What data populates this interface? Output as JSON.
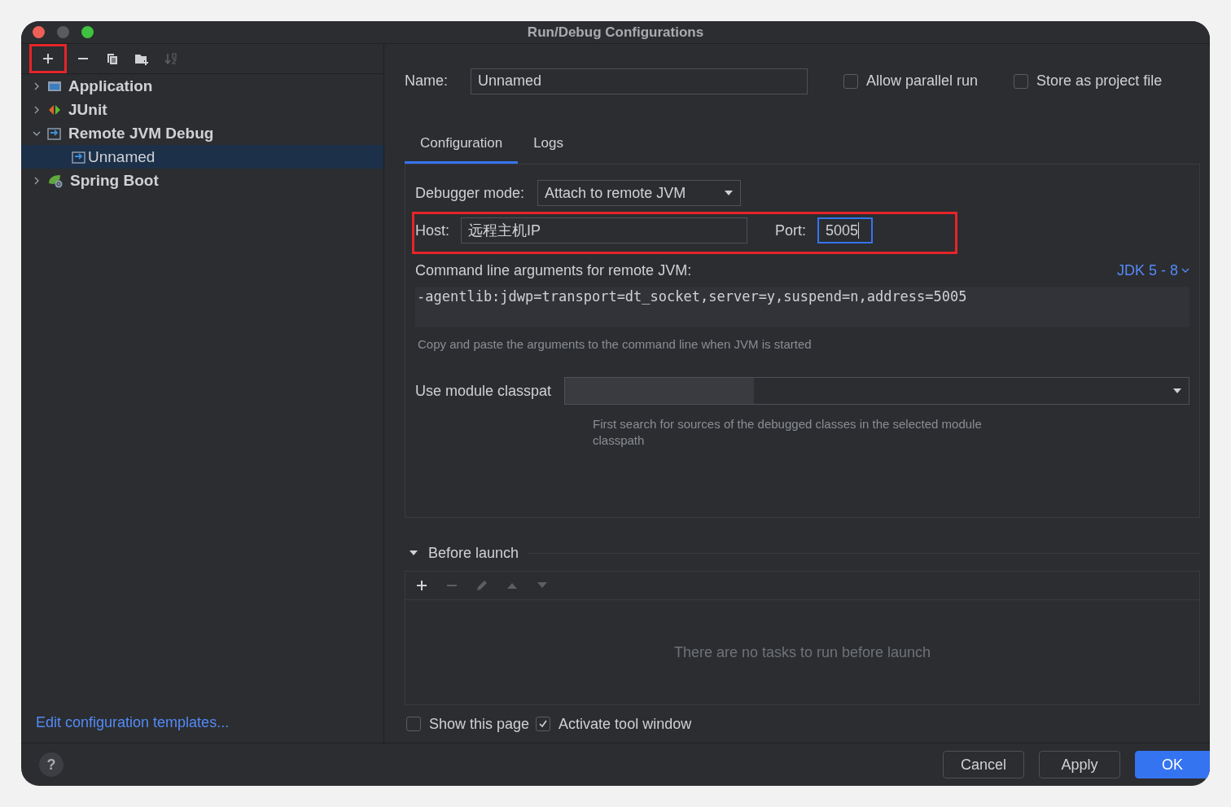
{
  "window": {
    "title": "Run/Debug Configurations"
  },
  "toolbar": [
    {
      "kind": "add",
      "disabled": false,
      "highlighted": true
    },
    {
      "kind": "remove",
      "disabled": false,
      "highlighted": false
    },
    {
      "kind": "copy",
      "disabled": false,
      "highlighted": false
    },
    {
      "kind": "folder",
      "disabled": false,
      "highlighted": false
    },
    {
      "kind": "sort",
      "disabled": true,
      "highlighted": false
    }
  ],
  "tree": [
    {
      "label": "Application",
      "kind": "application",
      "expanded": false,
      "selected": false
    },
    {
      "label": "JUnit",
      "kind": "junit",
      "expanded": false,
      "selected": false
    },
    {
      "label": "Remote JVM Debug",
      "kind": "remote",
      "expanded": true,
      "selected": false,
      "children": [
        {
          "label": "Unnamed",
          "kind": "remote",
          "selected": true
        }
      ]
    },
    {
      "label": "Spring Boot",
      "kind": "spring",
      "expanded": false,
      "selected": false
    }
  ],
  "help_button": "?",
  "edit_templates_link": "Edit configuration templates...",
  "name": {
    "label": "Name:",
    "value": "Unnamed"
  },
  "options": [
    {
      "label": "Allow parallel run",
      "checked": false
    },
    {
      "label": "Store as project file",
      "checked": false
    }
  ],
  "tabs": [
    {
      "label": "Configuration",
      "selected": true
    },
    {
      "label": "Logs",
      "selected": false
    }
  ],
  "debugger_mode": {
    "label": "Debugger mode:",
    "value": "Attach to remote JVM"
  },
  "host": {
    "label": "Host:",
    "value": "远程主机IP",
    "highlighted": true
  },
  "port": {
    "label": "Port:",
    "value": "5005",
    "focused": true
  },
  "command_line": {
    "label": "Command line arguments for remote JVM:",
    "jdk": "JDK 5 - 8",
    "value": "-agentlib:jdwp=transport=dt_socket,server=y,suspend=n,address=5005",
    "hint": "Copy and paste the arguments to the command line when JVM is started"
  },
  "module_classpath": {
    "label": "Use module classpat",
    "hint": "First search for sources of the debugged classes in the selected module classpath"
  },
  "before_launch": {
    "title": "Before launch",
    "expanded": true,
    "tools": [
      {
        "kind": "add",
        "disabled": false
      },
      {
        "kind": "remove",
        "disabled": true
      },
      {
        "kind": "edit",
        "disabled": true
      },
      {
        "kind": "up",
        "disabled": true
      },
      {
        "kind": "down",
        "disabled": true
      }
    ],
    "empty": "There are no tasks to run before launch"
  },
  "launch_options": [
    {
      "label": "Show this page",
      "checked": false
    },
    {
      "label": "Activate tool window",
      "checked": true
    }
  ],
  "buttons": [
    {
      "label": "Cancel",
      "default": false
    },
    {
      "label": "Apply",
      "default": false
    },
    {
      "label": "OK",
      "default": true
    }
  ]
}
